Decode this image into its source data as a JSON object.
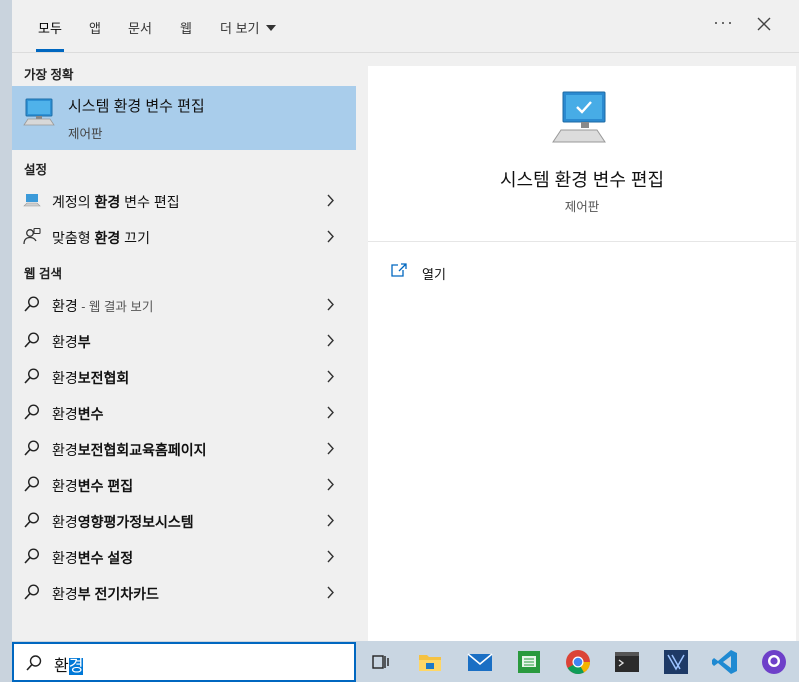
{
  "tabs": [
    "모두",
    "앱",
    "문서",
    "웹",
    "더 보기"
  ],
  "more_label": "···",
  "sections": {
    "best": "가장 정확",
    "settings": "설정",
    "web": "웹 검색"
  },
  "best_match": {
    "title": "시스템 환경 변수 편집",
    "subtitle": "제어판"
  },
  "settings_items": [
    {
      "pre": "계정의 ",
      "bold": "환경",
      "post": " 변수 편집"
    },
    {
      "pre": "맞춤형 ",
      "bold": "환경",
      "post": " 끄기"
    }
  ],
  "web_items": [
    {
      "pre": "환경",
      "bold": "",
      "sub": " - 웹 결과 보기"
    },
    {
      "pre": "환경",
      "bold": "부",
      "sub": ""
    },
    {
      "pre": "환경",
      "bold": "보전협회",
      "sub": ""
    },
    {
      "pre": "환경",
      "bold": "변수",
      "sub": ""
    },
    {
      "pre": "환경",
      "bold": "보전협회교육홈페이지",
      "sub": ""
    },
    {
      "pre": "환경",
      "bold": "변수 편집",
      "sub": ""
    },
    {
      "pre": "환경",
      "bold": "영향평가정보시스템",
      "sub": ""
    },
    {
      "pre": "환경",
      "bold": "변수 설정",
      "sub": ""
    },
    {
      "pre": "환경",
      "bold": "부 전기차카드",
      "sub": ""
    }
  ],
  "preview": {
    "title": "시스템 환경 변수 편집",
    "subtitle": "제어판",
    "open_label": "열기"
  },
  "search": {
    "typed": "환",
    "selected": "경"
  },
  "taskbar": [
    "task-view-icon",
    "file-explorer-icon",
    "mail-icon",
    "spreadsheet-icon",
    "chrome-icon",
    "terminal-icon",
    "network-tool-icon",
    "vscode-icon",
    "github-desktop-icon"
  ],
  "colors": {
    "accent": "#0067c0",
    "selected_row": "#a9cdeb",
    "panel": "#f0f0f0"
  }
}
